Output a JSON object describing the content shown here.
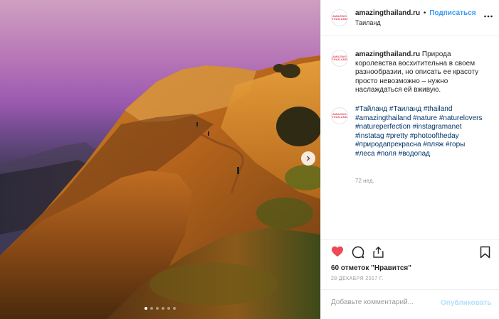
{
  "account": {
    "username": "amazingthailand.ru",
    "separator": "•",
    "follow_label": "Подписаться",
    "location": "Таиланд",
    "logo_text": "AMAZING THAILAND"
  },
  "post": {
    "caption": "Природа королевства восхитительна в своем разнообразии, но описать ее красоту просто невозможно – нужно наслаждаться ей вживую.",
    "hashtags": [
      "#Тайланд",
      "#Таиланд",
      "#thailand",
      "#amazingthailand",
      "#nature",
      "#naturelovers",
      "#natureperfection",
      "#instagramanet",
      "#instatag",
      "#pretty",
      "#photooftheday",
      "#природапрекрасна",
      "#пляж",
      "#горы",
      "#леса",
      "#поля",
      "#водопад"
    ],
    "age": "72 нед.",
    "likes": "60 отметок \"Нравится\"",
    "date": "28 ДЕКАБРЯ 2017 Г."
  },
  "comment": {
    "placeholder": "Добавьте комментарий...",
    "publish_label": "Опубликовать"
  },
  "carousel": {
    "slide_count": 6,
    "active_index": 0
  },
  "icons": {
    "more": "more-options-icon",
    "like": "heart-icon",
    "comment": "comment-icon",
    "share": "share-icon",
    "save": "bookmark-icon",
    "next": "chevron-right-icon"
  },
  "colors": {
    "like": "#ed4956",
    "link": "#3897f0",
    "hashtag": "#003569",
    "publish_disabled": "#b2dffc"
  }
}
